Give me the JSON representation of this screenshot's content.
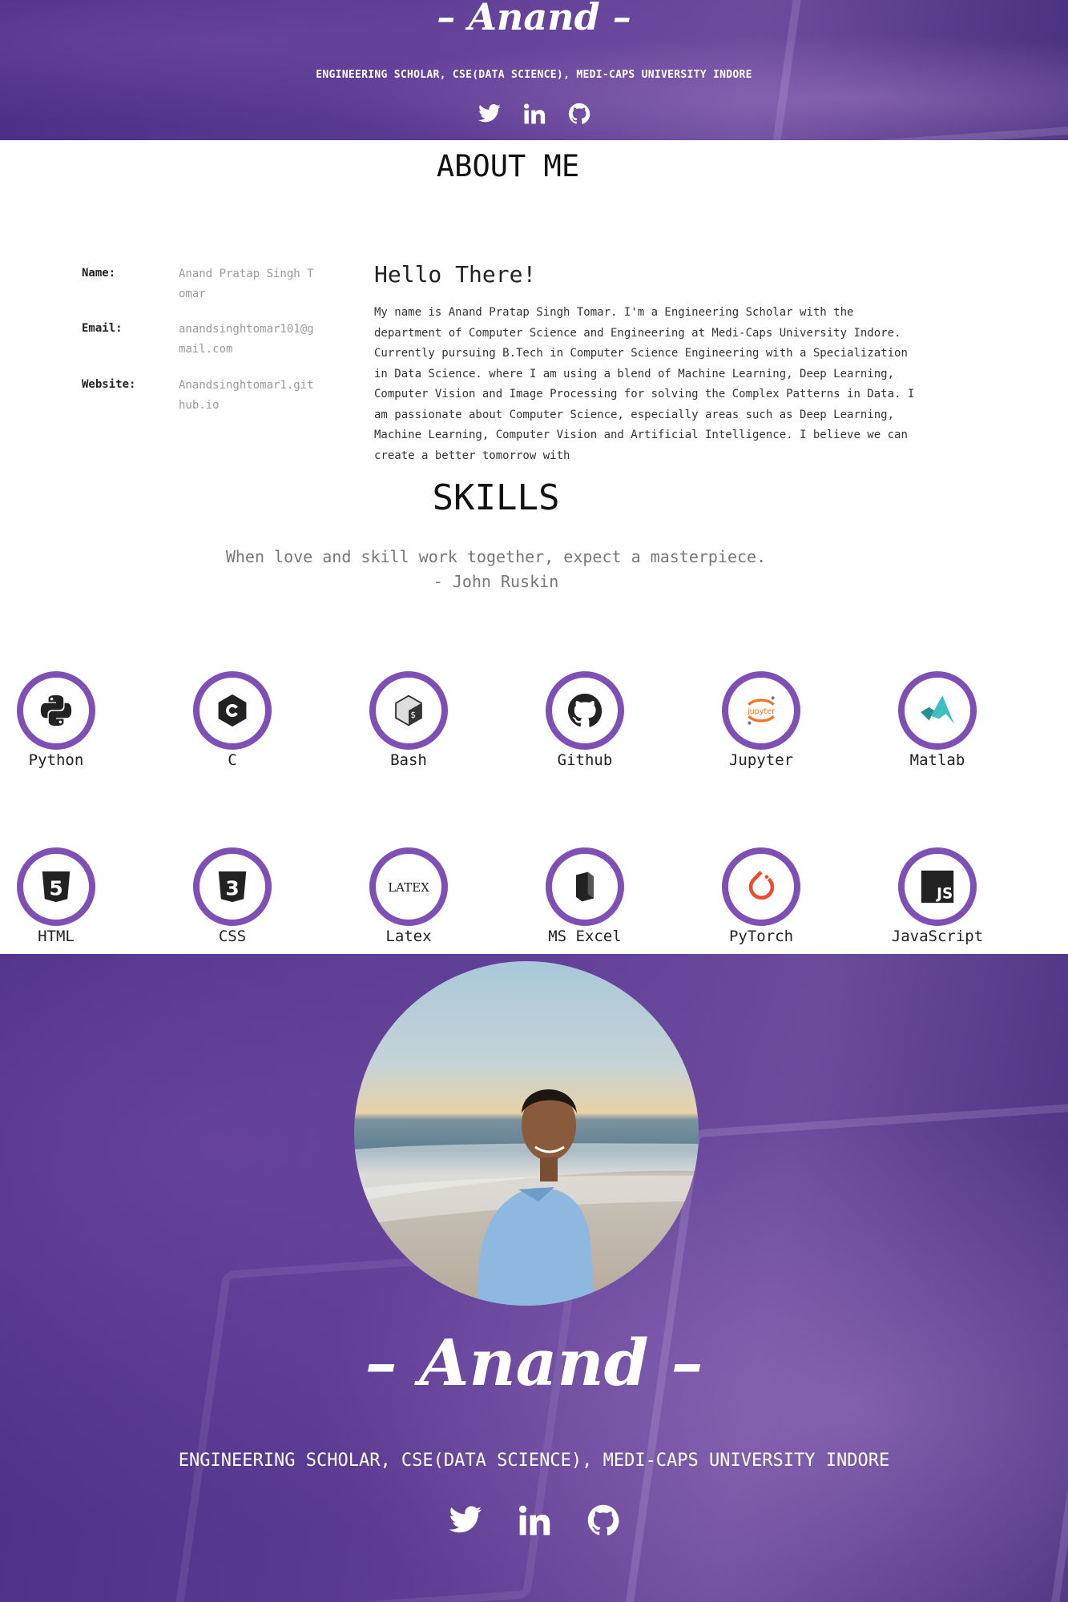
{
  "header": {
    "brand": "– Anand –",
    "subtitle": "ENGINEERING SCHOLAR, CSE(DATA SCIENCE), MEDI-CAPS UNIVERSITY INDORE",
    "social_icons": [
      "twitter-icon",
      "linkedin-icon",
      "github-icon"
    ]
  },
  "about": {
    "title": "ABOUT ME",
    "fields": [
      {
        "label": "Name:",
        "value": "Anand Pratap Singh Tomar"
      },
      {
        "label": "Email:",
        "value": "anandsinghtomar101@gmail.com"
      },
      {
        "label": "Website:",
        "value": "Anandsinghtomar1.github.io"
      }
    ],
    "greeting": "Hello There!",
    "bio": "My name is Anand Pratap Singh Tomar. I'm a Engineering Scholar with the department of Computer Science and Engineering at Medi-Caps University Indore. Currently pursuing B.Tech in Computer Science Engineering with a Specialization in Data Science. where I am using a blend of Machine Learning, Deep Learning, Computer Vision and Image Processing for solving the Complex Patterns in Data. I am passionate about Computer Science, especially areas such as Deep Learning, Machine Learning, Computer Vision and Artificial Intelligence. I believe we can create a better tomorrow with"
  },
  "skills": {
    "title": "SKILLS",
    "quote": "When love and skill work together, expect a masterpiece.",
    "author": "- John Ruskin",
    "items": [
      {
        "name": "Python",
        "icon": "python-icon"
      },
      {
        "name": "C",
        "icon": "c-language-icon"
      },
      {
        "name": "Bash",
        "icon": "bash-icon"
      },
      {
        "name": "Github",
        "icon": "github-icon"
      },
      {
        "name": "Jupyter",
        "icon": "jupyter-icon",
        "icon_text": "jupyter"
      },
      {
        "name": "Matlab",
        "icon": "matlab-icon"
      },
      {
        "name": "HTML",
        "icon": "html5-icon",
        "icon_text": "5"
      },
      {
        "name": "CSS",
        "icon": "css3-icon",
        "icon_text": "3"
      },
      {
        "name": "Latex",
        "icon": "latex-icon",
        "icon_text": "LATEX"
      },
      {
        "name": "MS Excel",
        "icon": "ms-excel-icon"
      },
      {
        "name": "PyTorch",
        "icon": "pytorch-icon"
      },
      {
        "name": "JavaScript",
        "icon": "javascript-icon",
        "icon_text": "JS"
      }
    ]
  },
  "footer": {
    "brand": "– Anand –",
    "subtitle": "ENGINEERING SCHOLAR, CSE(DATA SCIENCE), MEDI-CAPS UNIVERSITY INDORE",
    "social_icons": [
      "twitter-icon",
      "linkedin-icon",
      "github-icon"
    ]
  },
  "colors": {
    "accent": "#7e4fb5",
    "band": "#5a3b92"
  }
}
